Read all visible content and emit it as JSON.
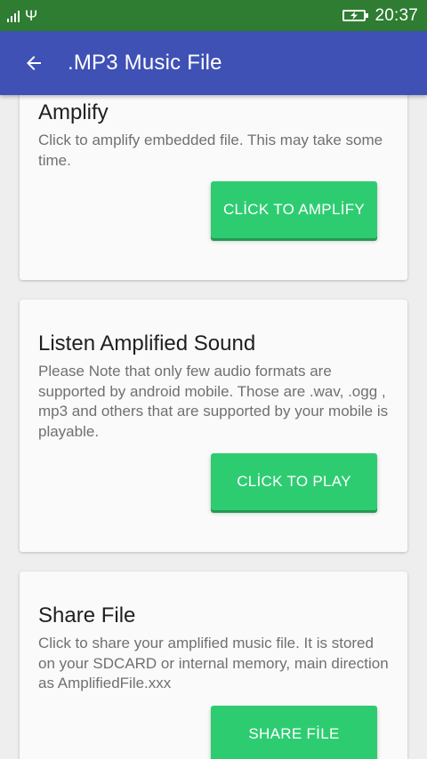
{
  "status_bar": {
    "time": "20:37",
    "usb_glyph": "Ψ",
    "icons": [
      "signal-icon",
      "usb-icon",
      "battery-charging-icon"
    ]
  },
  "app_bar": {
    "title": ".MP3 Music File",
    "back_icon": "arrow-back-icon"
  },
  "cards": [
    {
      "title": "Amplify",
      "description": "Click to amplify embedded file. This may take some time.",
      "button_label": "CLİCK TO AMPLİFY"
    },
    {
      "title": "Listen Amplified Sound",
      "description": "Please Note that only few audio formats are supported by android mobile. Those are .wav, .ogg , mp3 and others that are supported by your mobile is playable.",
      "button_label": "CLİCK TO PLAY"
    },
    {
      "title": "Share File",
      "description": "Click to share your amplified music file. It is stored on your SDCARD or internal memory, main direction as AmplifiedFile.xxx",
      "button_label": "SHARE FİLE"
    }
  ],
  "colors": {
    "status_bar": "#2e7d32",
    "app_bar": "#3f51b5",
    "button": "#2ecc71",
    "background": "#eeeeee",
    "card": "#fafafa"
  }
}
